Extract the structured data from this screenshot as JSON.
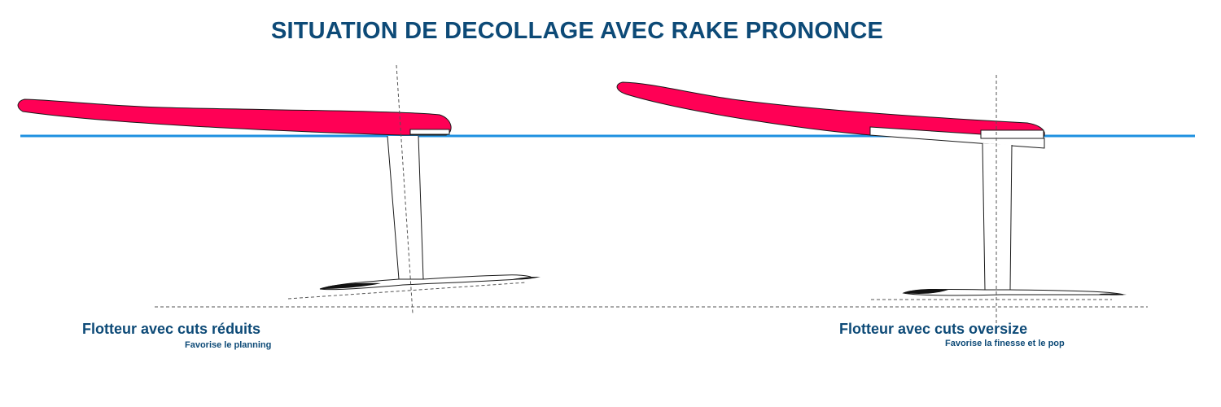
{
  "title": "SITUATION DE DECOLLAGE AVEC RAKE PRONONCE",
  "colors": {
    "title": "#0d4a77",
    "board": "#ff0055",
    "waterline": "#1e90e0",
    "outline": "#1a1a1a"
  },
  "left": {
    "caption": "Flotteur avec cuts réduits",
    "subcaption": "Favorise le planning"
  },
  "right": {
    "caption": "Flotteur avec cuts oversize",
    "subcaption": "Favorise la finesse et le pop"
  }
}
